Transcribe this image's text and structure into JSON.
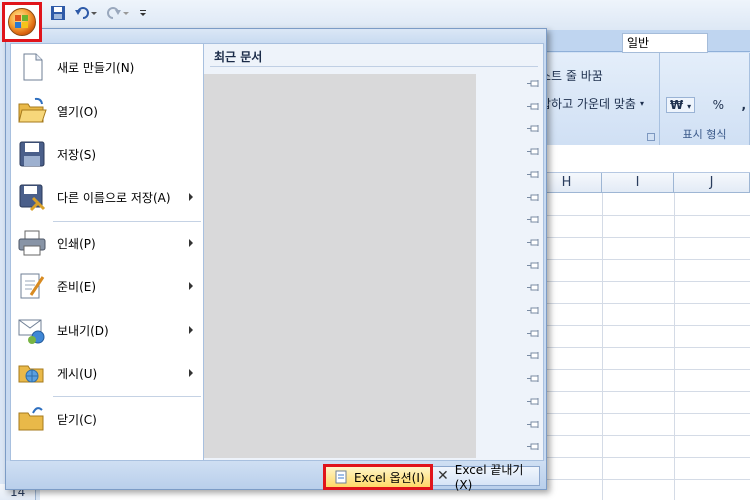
{
  "quick_access": {
    "icons": [
      "save-icon",
      "undo-icon",
      "redo-icon",
      "customize-qat-icon"
    ]
  },
  "ribbon": {
    "wrap_text_label": "스트 줄 바꿈",
    "merge_center_label": "합하고 가운데 맞춤",
    "number_format_value": "일반",
    "number_group_label": "표시 형식",
    "currency_symbol": "₩",
    "percent_symbol": "%",
    "comma_symbol": ","
  },
  "sheet": {
    "columns": [
      "H",
      "I",
      "J"
    ],
    "row_visible": "14"
  },
  "menu": {
    "items": [
      {
        "label": "새로 만들기(N)",
        "icon": "new-document-icon",
        "has_submenu": false
      },
      {
        "label": "열기(O)",
        "icon": "open-folder-icon",
        "has_submenu": false
      },
      {
        "label": "저장(S)",
        "icon": "save-disk-icon",
        "has_submenu": false
      },
      {
        "label": "다른 이름으로 저장(A)",
        "icon": "save-as-icon",
        "has_submenu": true
      },
      {
        "label": "인쇄(P)",
        "icon": "printer-icon",
        "has_submenu": true
      },
      {
        "label": "준비(E)",
        "icon": "prepare-icon",
        "has_submenu": true
      },
      {
        "label": "보내기(D)",
        "icon": "send-icon",
        "has_submenu": true
      },
      {
        "label": "게시(U)",
        "icon": "publish-icon",
        "has_submenu": true
      },
      {
        "label": "닫기(C)",
        "icon": "close-folder-icon",
        "has_submenu": false
      }
    ],
    "recent_title": "최근 문서",
    "pin_count": 18,
    "options_button": "Excel 옵션(I)",
    "exit_button": "Excel 끝내기(X)"
  },
  "colors": {
    "highlight_border": "#e0141b",
    "ribbon_bg": "#c5d9f1",
    "menu_bg": "#c8daf1"
  }
}
